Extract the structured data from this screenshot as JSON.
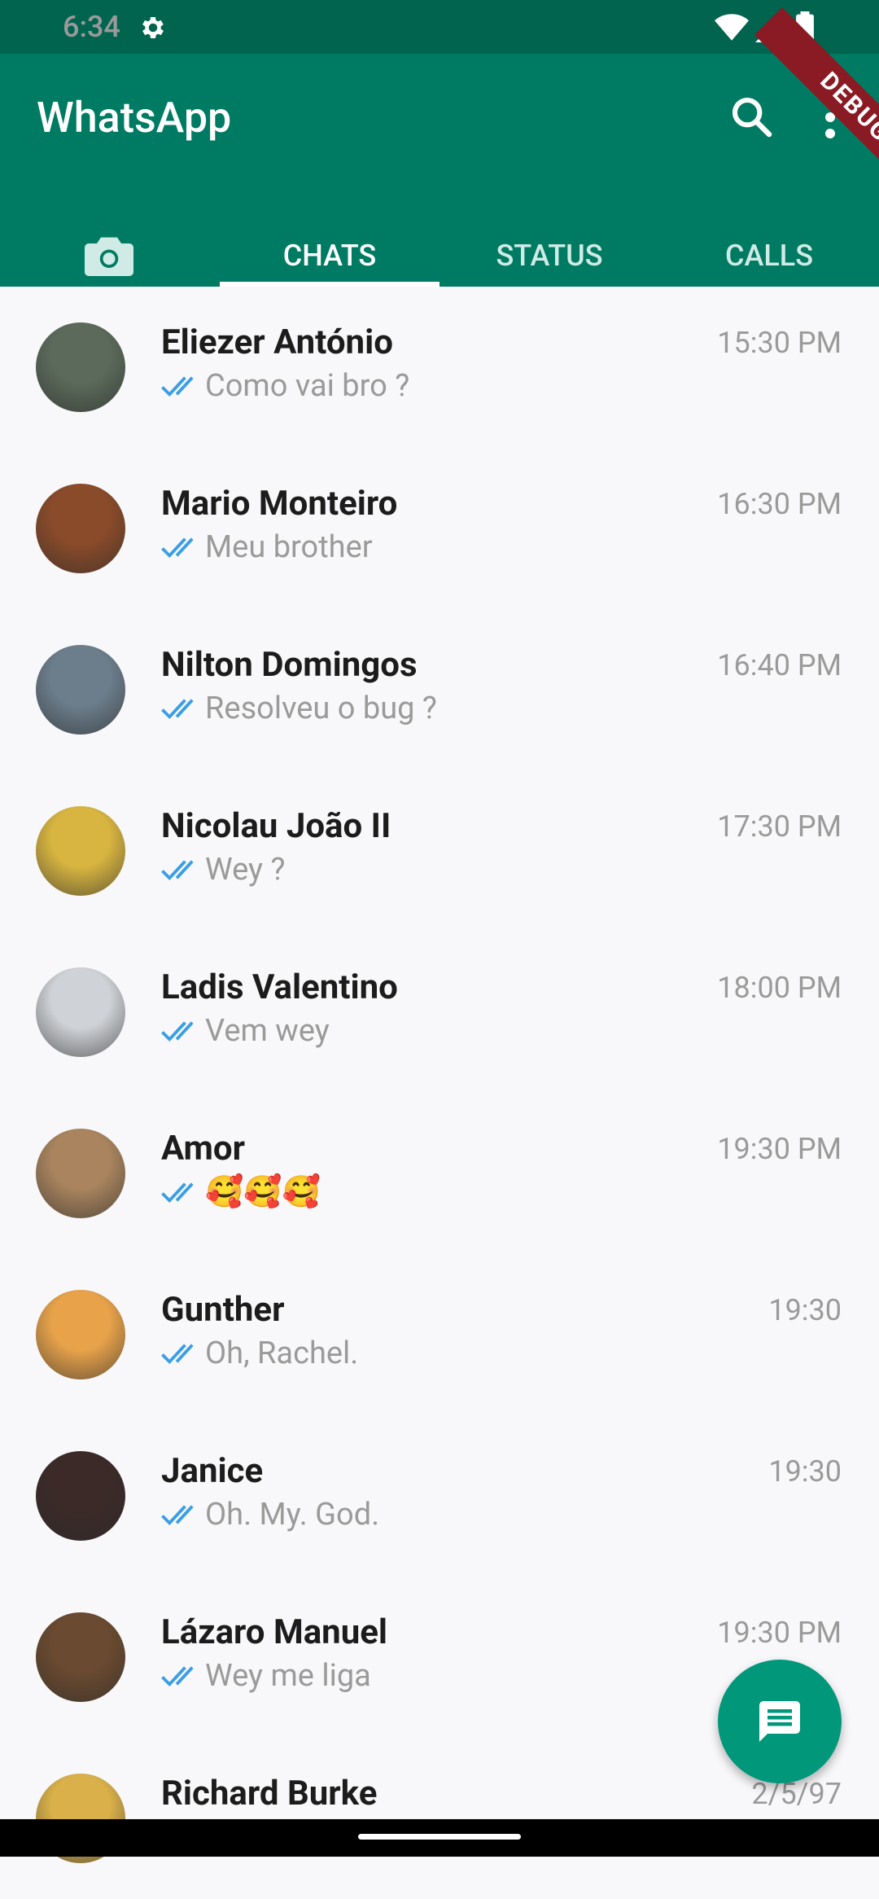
{
  "status_bar": {
    "time": "6:34"
  },
  "app_bar": {
    "title": "WhatsApp",
    "debug_label": "DEBUG",
    "tabs": [
      "CHATS",
      "STATUS",
      "CALLS"
    ]
  },
  "chats": [
    {
      "name": "Eliezer António",
      "message": "Como vai bro ?",
      "time": "15:30 PM",
      "avatar_color": "#5b6a5a"
    },
    {
      "name": "Mario Monteiro",
      "message": "Meu brother",
      "time": "16:30 PM",
      "avatar_color": "#8a4b2a"
    },
    {
      "name": "Nilton Domingos",
      "message": "Resolveu o bug ?",
      "time": "16:40 PM",
      "avatar_color": "#6c7e8c"
    },
    {
      "name": "Nicolau João II",
      "message": "Wey ?",
      "time": "17:30 PM",
      "avatar_color": "#d8b540"
    },
    {
      "name": "Ladis Valentino",
      "message": "Vem  wey",
      "time": "18:00 PM",
      "avatar_color": "#cfd2d6"
    },
    {
      "name": "Amor",
      "message": "🥰🥰🥰",
      "time": "19:30 PM",
      "avatar_color": "#a9845e"
    },
    {
      "name": "Gunther",
      "message": "Oh, Rachel.",
      "time": "19:30",
      "avatar_color": "#e7a24a"
    },
    {
      "name": "Janice",
      "message": "Oh. My. God.",
      "time": "19:30",
      "avatar_color": "#3b2a28"
    },
    {
      "name": "Lázaro Manuel",
      "message": "Wey me liga",
      "time": "19:30 PM",
      "avatar_color": "#6a4a30"
    },
    {
      "name": "Richard Burke",
      "message": "",
      "time": "2/5/97",
      "avatar_color": "#d9b04a"
    }
  ],
  "colors": {
    "status_bar": "#00644f",
    "app_bar": "#007b63",
    "fab": "#00977b",
    "tick_blue": "#3a9ee6"
  }
}
